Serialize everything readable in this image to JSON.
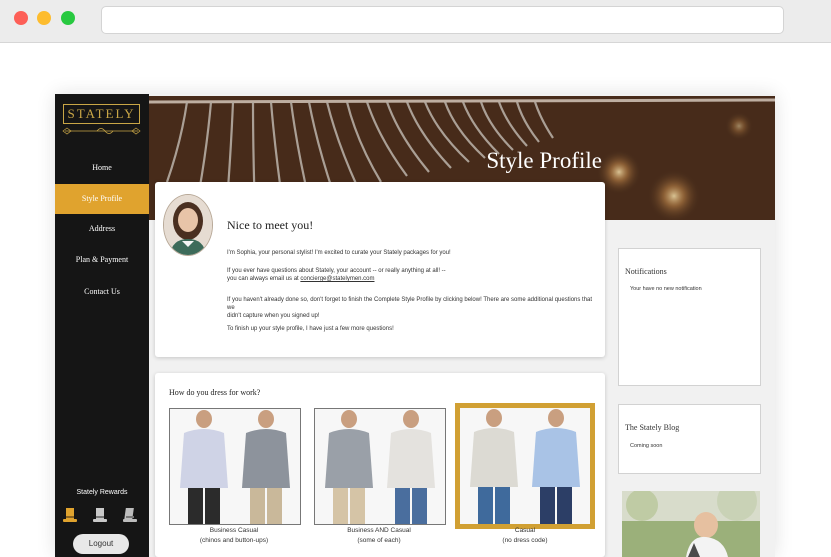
{
  "brand": {
    "logo_text": "STATELY"
  },
  "nav": {
    "items": [
      {
        "label": "Home"
      },
      {
        "label": "Style Profile"
      },
      {
        "label": "Address"
      },
      {
        "label": "Plan & Payment"
      },
      {
        "label": "Contact Us"
      }
    ]
  },
  "rewards": {
    "label": "Stately Rewards"
  },
  "logout": {
    "label": "Logout"
  },
  "hero": {
    "title": "Style Profile"
  },
  "intro": {
    "title": "Nice to meet you!",
    "p1": "I'm Sophia, your personal stylist! I'm excited to curate your Stately packages for you!",
    "p2a": "If you ever have questions about Stately, your account -- or really anything at all! --",
    "p2b": "you can always email us at",
    "email": "concierge@statelymen.com",
    "p3a": "If you haven't already done so, don't forget to finish the Complete Style Profile by clicking below! There are some additional questions that we",
    "p3b": "didn't capture when you signed up!",
    "p4": "To finish up your style profile, I have just a few more questions!"
  },
  "work": {
    "question": "How do you dress for work?",
    "options": [
      {
        "title": "Business Casual",
        "sub": "(chinos and button-ups)"
      },
      {
        "title": "Business AND Casual",
        "sub": "(some of each)"
      },
      {
        "title": "Casual",
        "sub": "(no dress code)"
      }
    ]
  },
  "notifications": {
    "title": "Notifications",
    "text": "Your have no new notification"
  },
  "blog": {
    "title": "The Stately Blog",
    "text": "Coming soon"
  },
  "colors": {
    "accent": "#e0a32e",
    "sidebar": "#151515",
    "selected_border": "#d1a033"
  }
}
